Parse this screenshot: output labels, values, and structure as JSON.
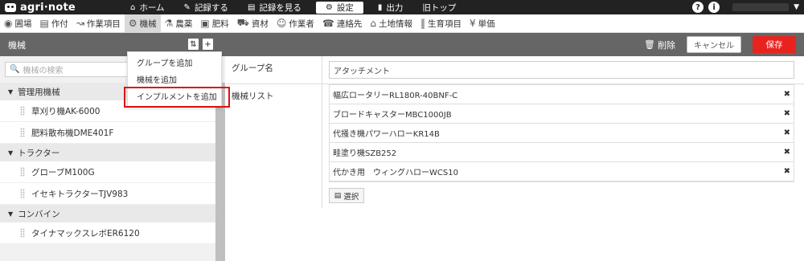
{
  "app": {
    "name": "agri·note"
  },
  "topnav": [
    {
      "icon": "⌂",
      "label": "ホーム"
    },
    {
      "icon": "✎",
      "label": "記録する"
    },
    {
      "icon": "▤",
      "label": "記録を見る"
    },
    {
      "icon": "⚙",
      "label": "設定",
      "active": true
    },
    {
      "icon": "▮",
      "label": "出力"
    },
    {
      "icon": "",
      "label": "旧トップ"
    }
  ],
  "topright": {
    "help": "?",
    "info": "i"
  },
  "subnav": [
    {
      "icon": "◉",
      "label": "圃場"
    },
    {
      "icon": "▤",
      "label": "作付"
    },
    {
      "icon": "↝",
      "label": "作業項目"
    },
    {
      "icon": "⚙",
      "label": "機械",
      "active": true
    },
    {
      "icon": "⚗",
      "label": "農薬"
    },
    {
      "icon": "▣",
      "label": "肥料"
    },
    {
      "icon": "⛟",
      "label": "資材"
    },
    {
      "icon": "☺",
      "label": "作業者"
    },
    {
      "icon": "☎",
      "label": "連絡先"
    },
    {
      "icon": "⌂",
      "label": "土地情報"
    },
    {
      "icon": "‖",
      "label": "生育項目"
    },
    {
      "icon": "¥",
      "label": "単価"
    }
  ],
  "titlebar": {
    "title": "機械",
    "delete": "削除",
    "cancel": "キャンセル",
    "save": "保存"
  },
  "search": {
    "placeholder": "機械の検索"
  },
  "tree": [
    {
      "group": "管理用機械",
      "items": [
        "草刈り機AK-6000",
        "肥料散布機DME401F"
      ]
    },
    {
      "group": "トラクター",
      "items": [
        "グローブM100G",
        "イセキトラクターTJV983"
      ]
    },
    {
      "group": "コンバイン",
      "items": [
        "タイナマックスレボER6120"
      ]
    }
  ],
  "menu": [
    "グループを追加",
    "機械を追加",
    "インプルメントを追加"
  ],
  "form": {
    "group_label": "グループ名",
    "group_value": "アタッチメント",
    "list_label": "機械リスト",
    "list": [
      "幅広ロータリーRL180R-40BNF-C",
      "ブロードキャスターMBC1000JB",
      "代掻き機パワーハローKR14B",
      "畦塗り機SZB252",
      "代かき用　ウィングハローWCS10"
    ],
    "select_label": "選択"
  }
}
